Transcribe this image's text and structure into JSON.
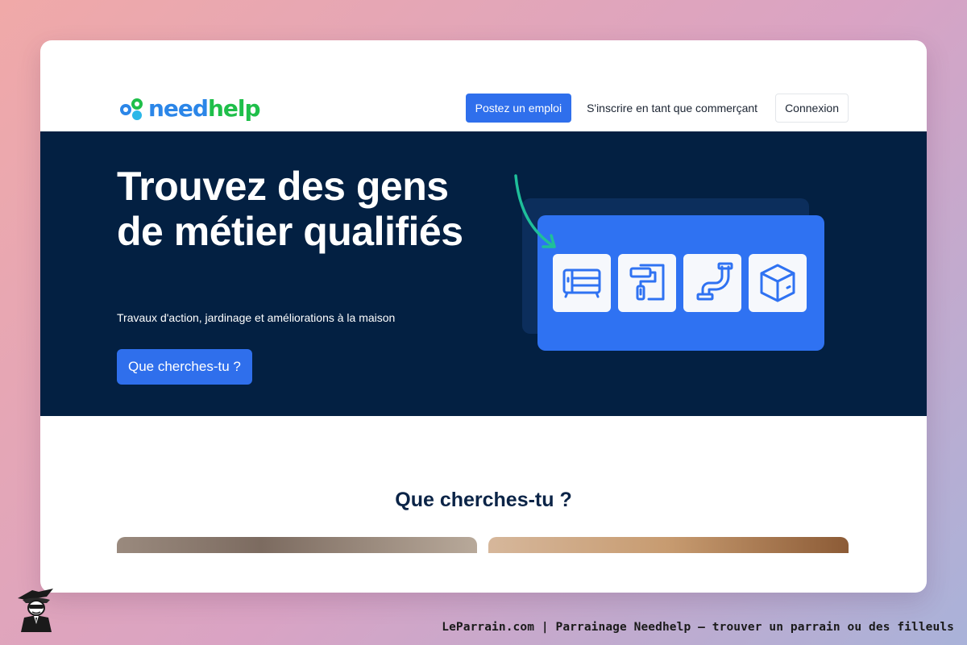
{
  "header": {
    "logo": {
      "part1": "need",
      "part2": "help"
    },
    "nav": {
      "post_job": "Postez un emploi",
      "register_merchant": "S'inscrire en tant que commerçant",
      "login": "Connexion"
    }
  },
  "hero": {
    "title": "Trouvez des gens de métier qualifiés",
    "subtitle": "Travaux d'action, jardinage et améliorations à la maison",
    "cta": "Que cherches-tu ?",
    "tiles": [
      "sofa-icon",
      "paint-roller-icon",
      "pipe-icon",
      "box-icon"
    ]
  },
  "section": {
    "title": "Que cherches-tu ?"
  },
  "footer": {
    "caption": "LeParrain.com | Parrainage Needhelp — trouver un parrain ou des filleuls"
  },
  "colors": {
    "hero_bg": "#032042",
    "primary": "#2f6fec",
    "logo_blue": "#2b86e8",
    "logo_green": "#1fbf4a",
    "arrow": "#1fbf9a"
  }
}
